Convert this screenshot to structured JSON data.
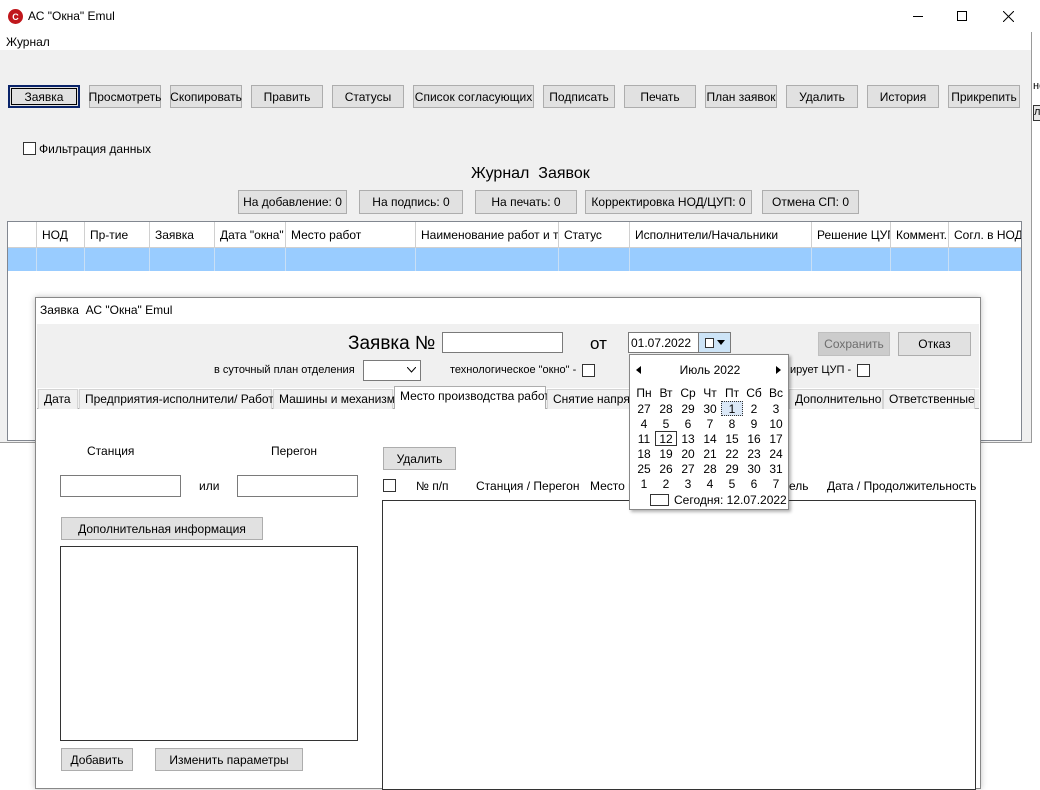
{
  "app": {
    "title": "АС \"Окна\" Emul",
    "menu": [
      "Журнал"
    ]
  },
  "window_controls": {
    "minimize": "—",
    "maximize": "☐",
    "close": "✕"
  },
  "toolbar": [
    "Заявка",
    "Просмотреть",
    "Скопировать",
    "Править",
    "Статусы",
    "Список согласующих",
    "Подписать",
    "Печать",
    "План заявок",
    "Удалить",
    "История",
    "Прикрепить"
  ],
  "filter_label": "Фильтрация данных",
  "journal_title": "Журнал  Заявок",
  "counters": [
    "На добавление: 0",
    "На подпись: 0",
    "На печать: 0",
    "Корректировка НОД/ЦУП: 0",
    "Отмена СП: 0"
  ],
  "grid_columns": [
    "НОД",
    "Пр-тие",
    "Заявка",
    "Дата \"окна\"",
    "Место работ",
    "Наименование работ и тех",
    "Статус",
    "Исполнители/Начальники",
    "Решение ЦУП",
    "Коммент.",
    "Согл. в НОД"
  ],
  "right_edge_fragments": [
    "не",
    "ла"
  ],
  "dialog": {
    "title": "Заявка  АС \"Окна\" Emul",
    "request_label": "Заявка №",
    "request_number": "",
    "from_label": "от",
    "date_value": "01.07.2022",
    "save_label": "Сохранить",
    "cancel_label": "Отказ",
    "daily_plan_label": "в суточный план отделения",
    "tech_window_label": "технологическое \"окно\" -",
    "cup_label": "ирует ЦУП -",
    "tabs": [
      "Дата",
      "Предприятия-исполнители/ Работы",
      "Машины и механизмы",
      "Место производства работ",
      "Снятие напряже",
      "Дополнительно",
      "Ответственные"
    ],
    "station_label": "Станция",
    "span_label": "Перегон",
    "or_label": "или",
    "extra_info_label": "Дополнительная информация",
    "add_label": "Добавить",
    "change_params_label": "Изменить параметры",
    "delete_label": "Удалить",
    "list_columns": [
      "№ п/п",
      "Станция / Перегон",
      "Место п",
      "ель",
      "Дата / Продолжительность"
    ]
  },
  "calendar": {
    "month": "Июль 2022",
    "weekdays": [
      "Пн",
      "Вт",
      "Ср",
      "Чт",
      "Пт",
      "Сб",
      "Вс"
    ],
    "weeks": [
      [
        "27",
        "28",
        "29",
        "30",
        "1",
        "2",
        "3"
      ],
      [
        "4",
        "5",
        "6",
        "7",
        "8",
        "9",
        "10"
      ],
      [
        "11",
        "12",
        "13",
        "14",
        "15",
        "16",
        "17"
      ],
      [
        "18",
        "19",
        "20",
        "21",
        "22",
        "23",
        "24"
      ],
      [
        "25",
        "26",
        "27",
        "28",
        "29",
        "30",
        "31"
      ],
      [
        "1",
        "2",
        "3",
        "4",
        "5",
        "6",
        "7"
      ]
    ],
    "today_label": "Сегодня: 12.07.2022",
    "selected_day": "1",
    "today_day": "12"
  }
}
